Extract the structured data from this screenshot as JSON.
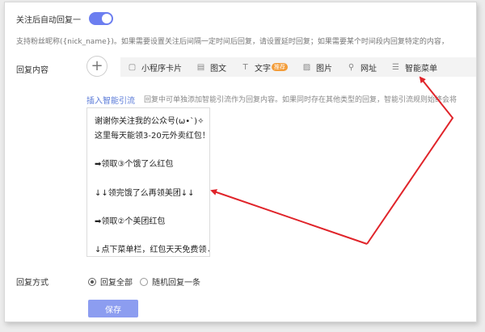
{
  "follow_reply": {
    "label": "关注后自动回复一",
    "enabled": true
  },
  "tip": "支持粉丝昵称({nick_name})。如果需要设置关注后间隔一定时间后回复，请设置延时回复；如果需要某个时间段内回复特定的内容，",
  "reply_content": {
    "label": "回复内容",
    "add_symbol": "+",
    "toolbar": [
      {
        "icon": "miniprogram-card-icon",
        "glyph": "▢",
        "label": "小程序卡片",
        "badge": ""
      },
      {
        "icon": "image-text-icon",
        "glyph": "▤",
        "label": "图文",
        "badge": ""
      },
      {
        "icon": "text-icon",
        "glyph": "T",
        "label": "文字",
        "badge": "推荐"
      },
      {
        "icon": "image-icon",
        "glyph": "▨",
        "label": "图片",
        "badge": ""
      },
      {
        "icon": "link-icon",
        "glyph": "⚲",
        "label": "网址",
        "badge": ""
      },
      {
        "icon": "menu-icon",
        "glyph": "☰",
        "label": "智能菜单",
        "badge": ""
      }
    ],
    "smart_link": "插入智能引流",
    "smart_desc": "回复中可单独添加智能引流作为回复内容。如果同时存在其他类型的回复，智能引流规则始终会将",
    "message_lines": [
      "谢谢你关注我的公众号(ω•ˋ)✧",
      "这里每天能领3-20元外卖红包！",
      "",
      "➡领取③个饿了么红包",
      "",
      "↓↓领完饿了么再领美团↓↓",
      "",
      "➡领取②个美团红包",
      "",
      "↓点下菜单栏，红包天天免费领↓"
    ]
  },
  "reply_mode": {
    "label": "回复方式",
    "options": [
      {
        "label": "回复全部",
        "selected": true
      },
      {
        "label": "随机回复一条",
        "selected": false
      }
    ]
  },
  "save_label": "保存",
  "colors": {
    "accent": "#6c7ef0",
    "save_button": "#8c9df0",
    "link": "#5b7bd8",
    "arrow": "#e0242a",
    "badge": "#f39c38"
  }
}
